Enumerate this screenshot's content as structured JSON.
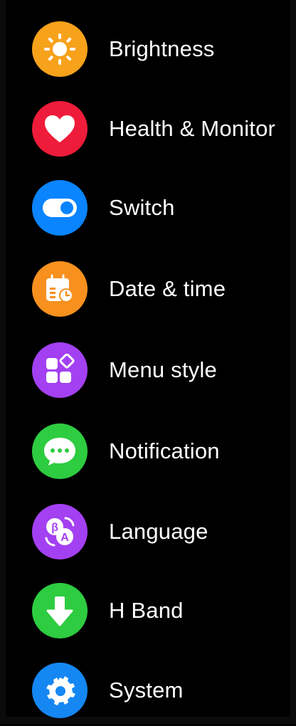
{
  "menu": {
    "items": [
      {
        "label": "Brightness",
        "icon": "sun-icon",
        "color": "#F7A21B"
      },
      {
        "label": "Health & Monitor",
        "icon": "heart-icon",
        "color": "#EE1C3A"
      },
      {
        "label": "Switch",
        "icon": "toggle-icon",
        "color": "#0A84FF"
      },
      {
        "label": "Date & time",
        "icon": "calendar-clock-icon",
        "color": "#F7901E"
      },
      {
        "label": "Menu style",
        "icon": "grid-icon",
        "color": "#A340F2"
      },
      {
        "label": "Notification",
        "icon": "chat-bubble-icon",
        "color": "#2ECC40"
      },
      {
        "label": "Language",
        "icon": "translate-icon",
        "color": "#A340F2"
      },
      {
        "label": "H Band",
        "icon": "download-arrow-icon",
        "color": "#2ECC40"
      },
      {
        "label": "System",
        "icon": "gear-icon",
        "color": "#1587F2"
      }
    ]
  }
}
